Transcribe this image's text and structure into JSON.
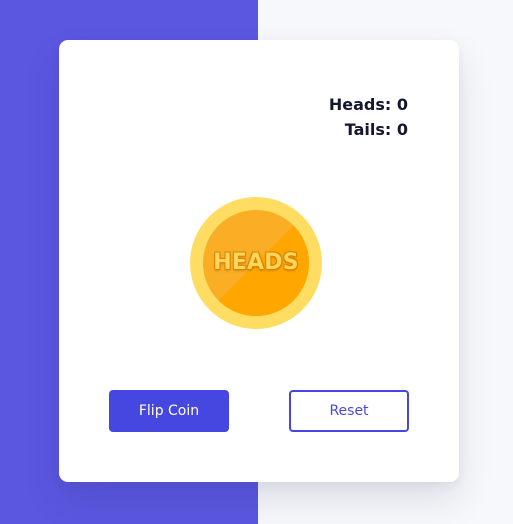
{
  "score": {
    "heads_label": "Heads: 0",
    "tails_label": "Tails: 0",
    "heads_count": 0,
    "tails_count": 0
  },
  "coin": {
    "face_label": "HEADS",
    "side": "heads"
  },
  "buttons": {
    "flip_label": "Flip Coin",
    "reset_label": "Reset"
  },
  "colors": {
    "background_left": "#5b57e0",
    "background_right": "#f7f8fb",
    "card": "#ffffff",
    "primary": "#4647e0",
    "text": "#15172f",
    "coin_outer": "#ffdd63",
    "coin_inner": "#f9ae26",
    "coin_shade": "#ffa700"
  }
}
